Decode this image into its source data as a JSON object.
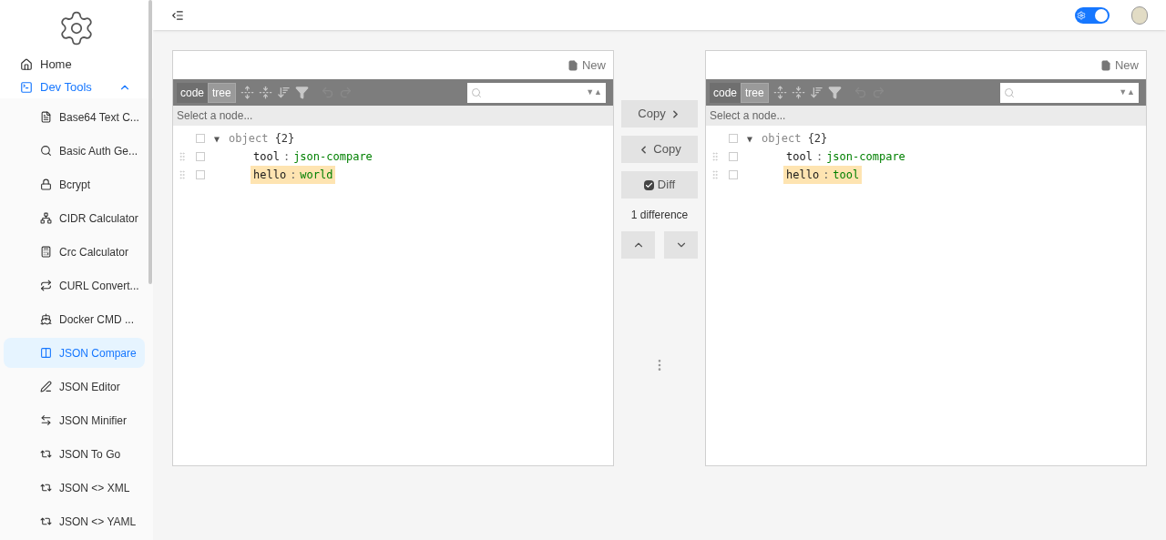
{
  "sidebar": {
    "home": {
      "label": "Home",
      "selected": false
    },
    "group": {
      "label": "Dev Tools",
      "expanded": true,
      "children": [
        {
          "label": "Base64 Text C...",
          "selected": false
        },
        {
          "label": "Basic Auth Ge...",
          "selected": false
        },
        {
          "label": "Bcrypt",
          "selected": false
        },
        {
          "label": "CIDR Calculator",
          "selected": false
        },
        {
          "label": "Crc Calculator",
          "selected": false
        },
        {
          "label": "CURL Convert...",
          "selected": false
        },
        {
          "label": "Docker CMD ...",
          "selected": false
        },
        {
          "label": "JSON Compare",
          "selected": true
        },
        {
          "label": "JSON Editor",
          "selected": false
        },
        {
          "label": "JSON Minifier",
          "selected": false
        },
        {
          "label": "JSON To Go",
          "selected": false
        },
        {
          "label": "JSON <> XML",
          "selected": false
        },
        {
          "label": "JSON <> YAML",
          "selected": false
        }
      ]
    }
  },
  "header": {
    "theme_toggle": {
      "on": true
    }
  },
  "editors": [
    {
      "new_button": "New",
      "modes": [
        {
          "label": "code",
          "selected": false
        },
        {
          "label": "tree",
          "selected": true
        }
      ],
      "search_nav": "▼▲",
      "status": "Select a node...",
      "tree": {
        "toggle": "▼",
        "key": "object",
        "count": "{2}",
        "checked": false,
        "expanded": true,
        "children": [
          {
            "key": "tool",
            "separator": ":",
            "value": "json-compare",
            "checked": false,
            "highlighted": false
          },
          {
            "key": "hello",
            "separator": ":",
            "value": "world",
            "checked": false,
            "highlighted": true
          }
        ]
      }
    },
    {
      "new_button": "New",
      "modes": [
        {
          "label": "code",
          "selected": false
        },
        {
          "label": "tree",
          "selected": true
        }
      ],
      "search_nav": "▼▲",
      "status": "Select a node...",
      "tree": {
        "toggle": "▼",
        "key": "object",
        "count": "{2}",
        "checked": false,
        "expanded": true,
        "children": [
          {
            "key": "tool",
            "separator": ":",
            "value": "json-compare",
            "checked": false,
            "highlighted": false
          },
          {
            "key": "hello",
            "separator": ":",
            "value": "tool",
            "checked": false,
            "highlighted": true
          }
        ]
      }
    }
  ],
  "compare": {
    "copy_right": "Copy",
    "copy_left": "Copy",
    "diff": {
      "label": "Diff",
      "checked": true
    },
    "difference_count": "1 difference"
  }
}
